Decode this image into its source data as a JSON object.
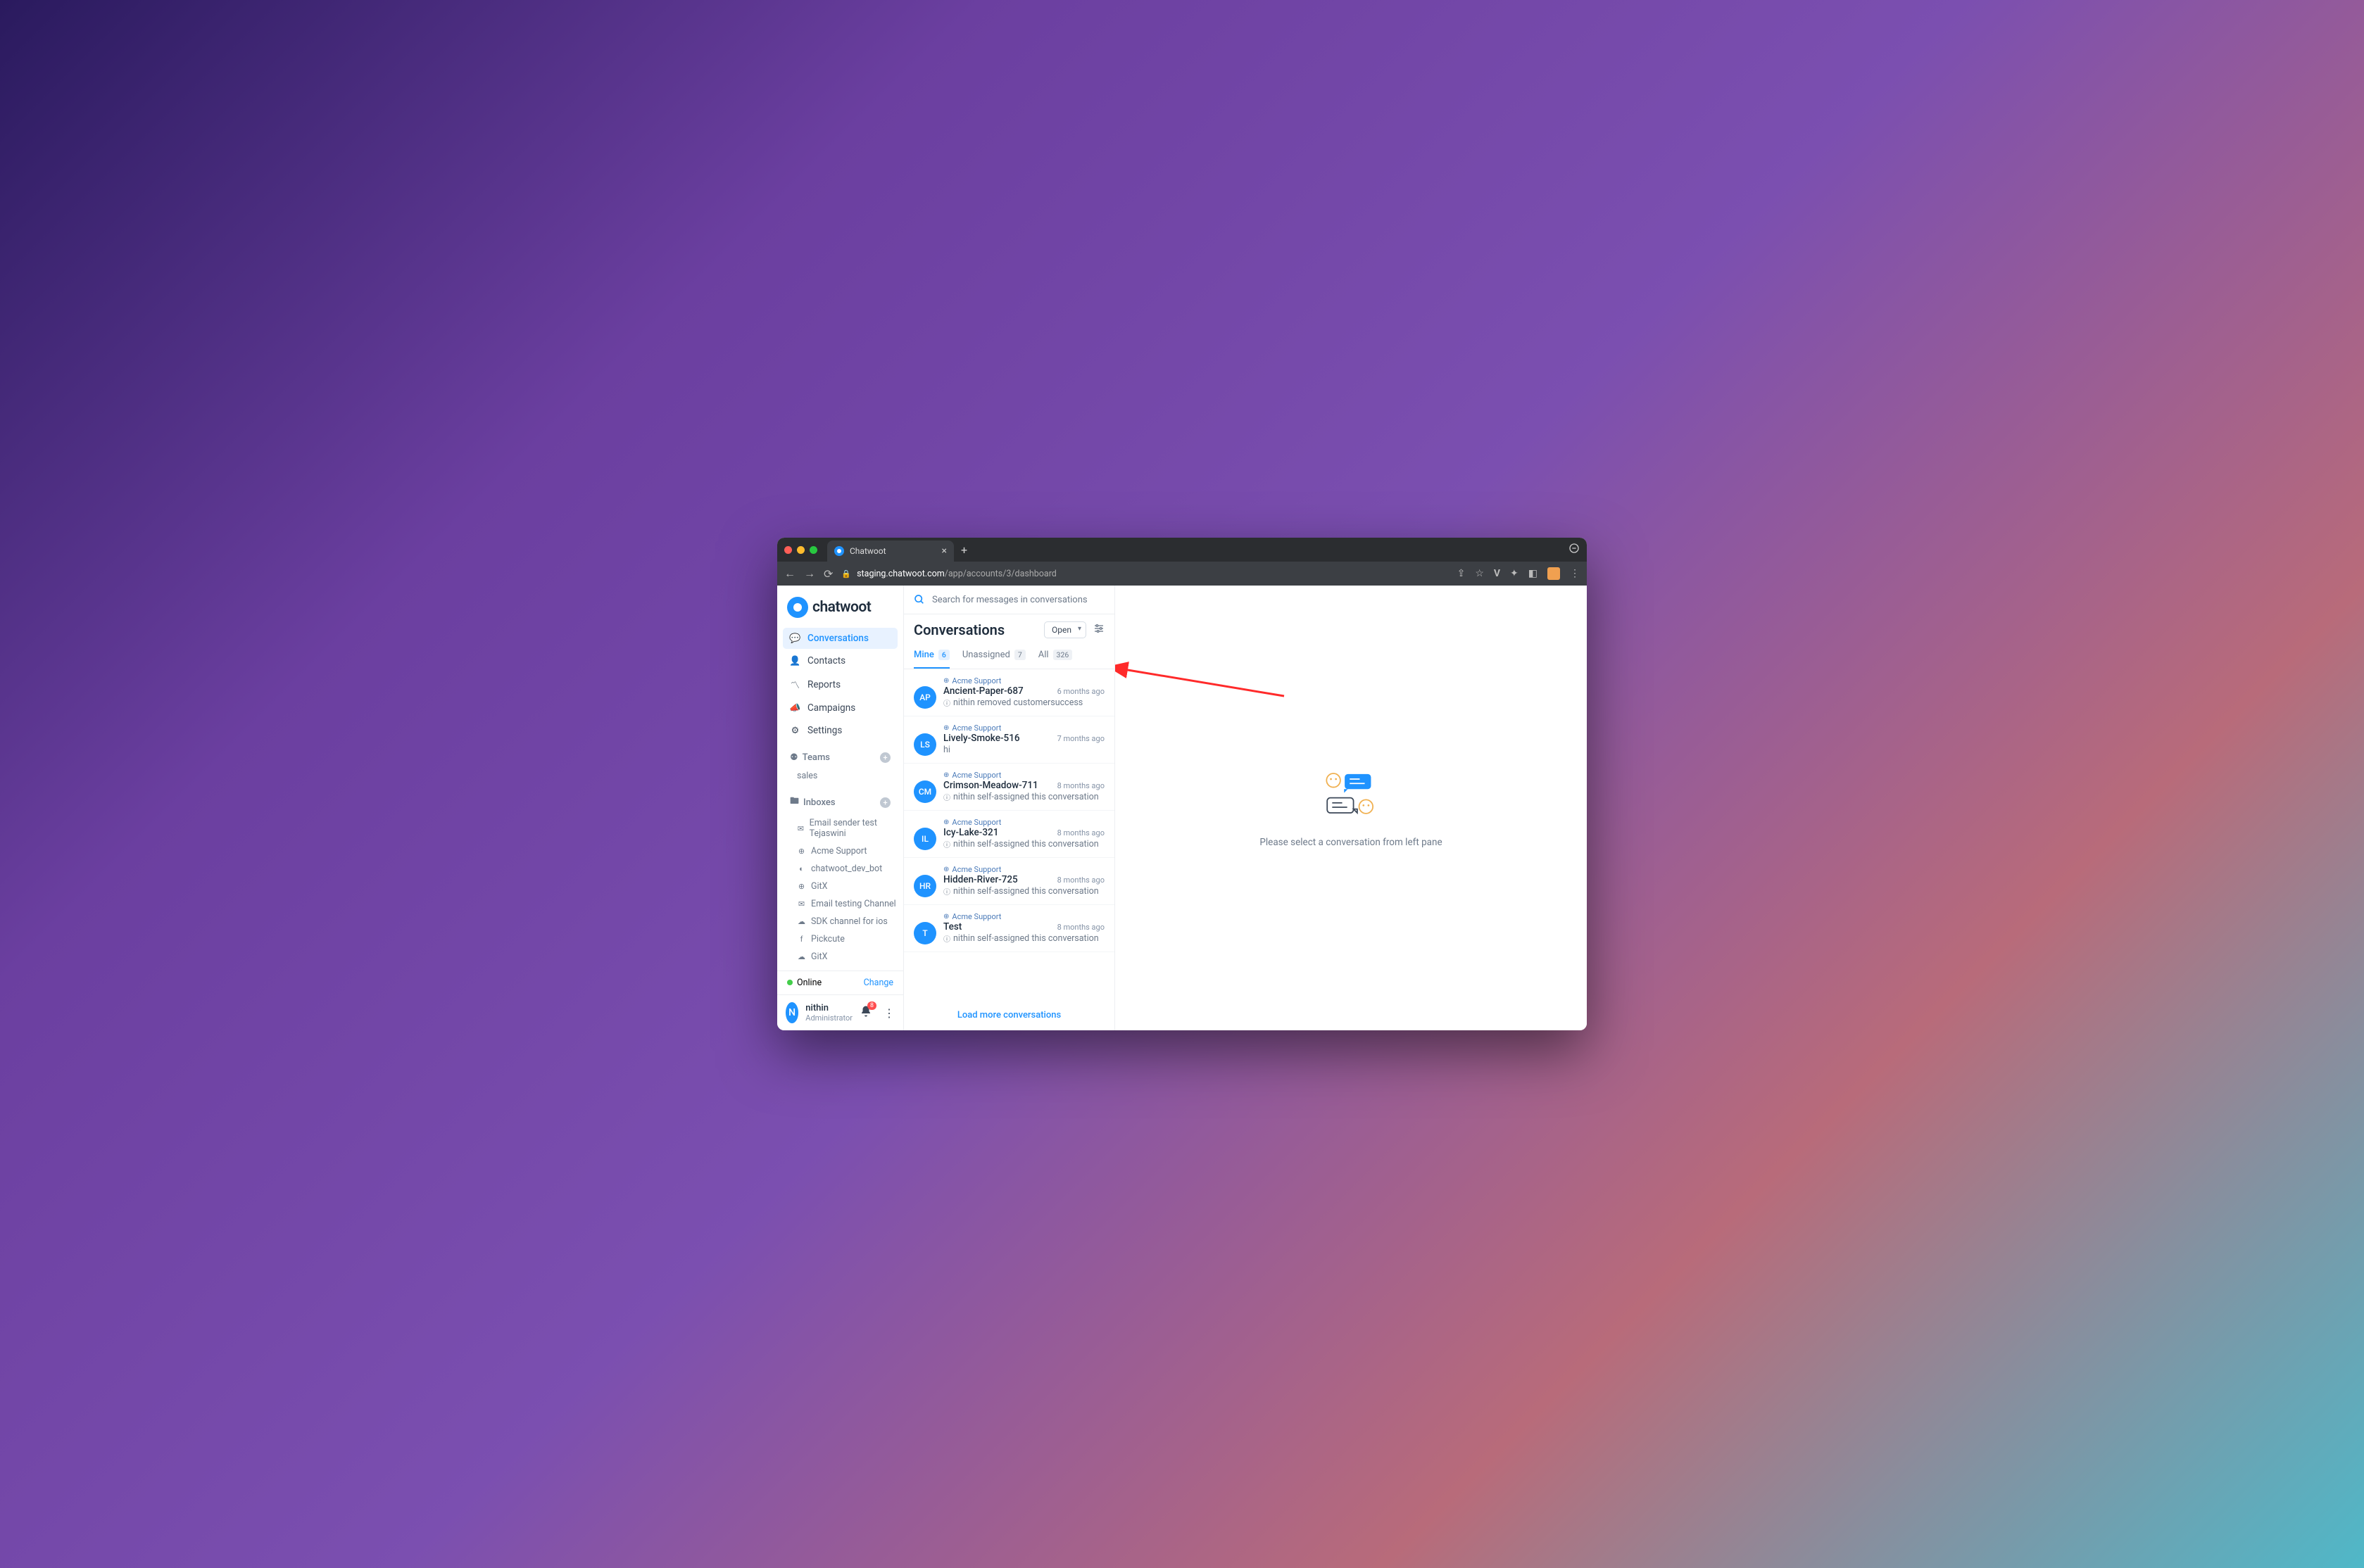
{
  "browser": {
    "tab_title": "Chatwoot",
    "url_domain": "staging.chatwoot.com",
    "url_path": "/app/accounts/3/dashboard"
  },
  "logo_text": "chatwoot",
  "nav": {
    "conversations": "Conversations",
    "contacts": "Contacts",
    "reports": "Reports",
    "campaigns": "Campaigns",
    "settings": "Settings"
  },
  "teams": {
    "header": "Teams",
    "items": [
      "sales"
    ]
  },
  "inboxes": {
    "header": "Inboxes",
    "items": [
      {
        "icon": "✉",
        "label": "Email sender test Tejaswini"
      },
      {
        "icon": "⊕",
        "label": "Acme Support"
      },
      {
        "icon": "◐",
        "label": "chatwoot_dev_bot"
      },
      {
        "icon": "⊕",
        "label": "GitX"
      },
      {
        "icon": "✉",
        "label": "Email testing Channel"
      },
      {
        "icon": "☁",
        "label": "SDK channel for ios"
      },
      {
        "icon": "f",
        "label": "Pickcute"
      },
      {
        "icon": "☁",
        "label": "GitX"
      }
    ]
  },
  "status": {
    "label": "Online",
    "change": "Change"
  },
  "user": {
    "initial": "N",
    "name": "nithin",
    "role": "Administrator",
    "notif_count": "8"
  },
  "search_placeholder": "Search for messages in conversations",
  "convo_header": {
    "title": "Conversations",
    "status_filter": "Open"
  },
  "tabs": [
    {
      "label": "Mine",
      "count": "6"
    },
    {
      "label": "Unassigned",
      "count": "7"
    },
    {
      "label": "All",
      "count": "326"
    }
  ],
  "conversations": [
    {
      "initials": "AP",
      "color": "#1f93ff",
      "inbox": "Acme Support",
      "name": "Ancient-Paper-687",
      "time": "6 months ago",
      "msg": "nithin removed customersuccess",
      "sys": true
    },
    {
      "initials": "LS",
      "color": "#1f93ff",
      "inbox": "Acme Support",
      "name": "Lively-Smoke-516",
      "time": "7 months ago",
      "msg": "hi",
      "sys": false
    },
    {
      "initials": "CM",
      "color": "#1f93ff",
      "inbox": "Acme Support",
      "name": "Crimson-Meadow-711",
      "time": "8 months ago",
      "msg": "nithin self-assigned this conversation",
      "sys": true
    },
    {
      "initials": "IL",
      "color": "#1f93ff",
      "inbox": "Acme Support",
      "name": "Icy-Lake-321",
      "time": "8 months ago",
      "msg": "nithin self-assigned this conversation",
      "sys": true
    },
    {
      "initials": "HR",
      "color": "#1f93ff",
      "inbox": "Acme Support",
      "name": "Hidden-River-725",
      "time": "8 months ago",
      "msg": "nithin self-assigned this conversation",
      "sys": true
    },
    {
      "initials": "T",
      "color": "#1f93ff",
      "inbox": "Acme Support",
      "name": "Test",
      "time": "8 months ago",
      "msg": "nithin self-assigned this conversation",
      "sys": true
    }
  ],
  "load_more": "Load more conversations",
  "empty_state": "Please select a conversation from left pane"
}
